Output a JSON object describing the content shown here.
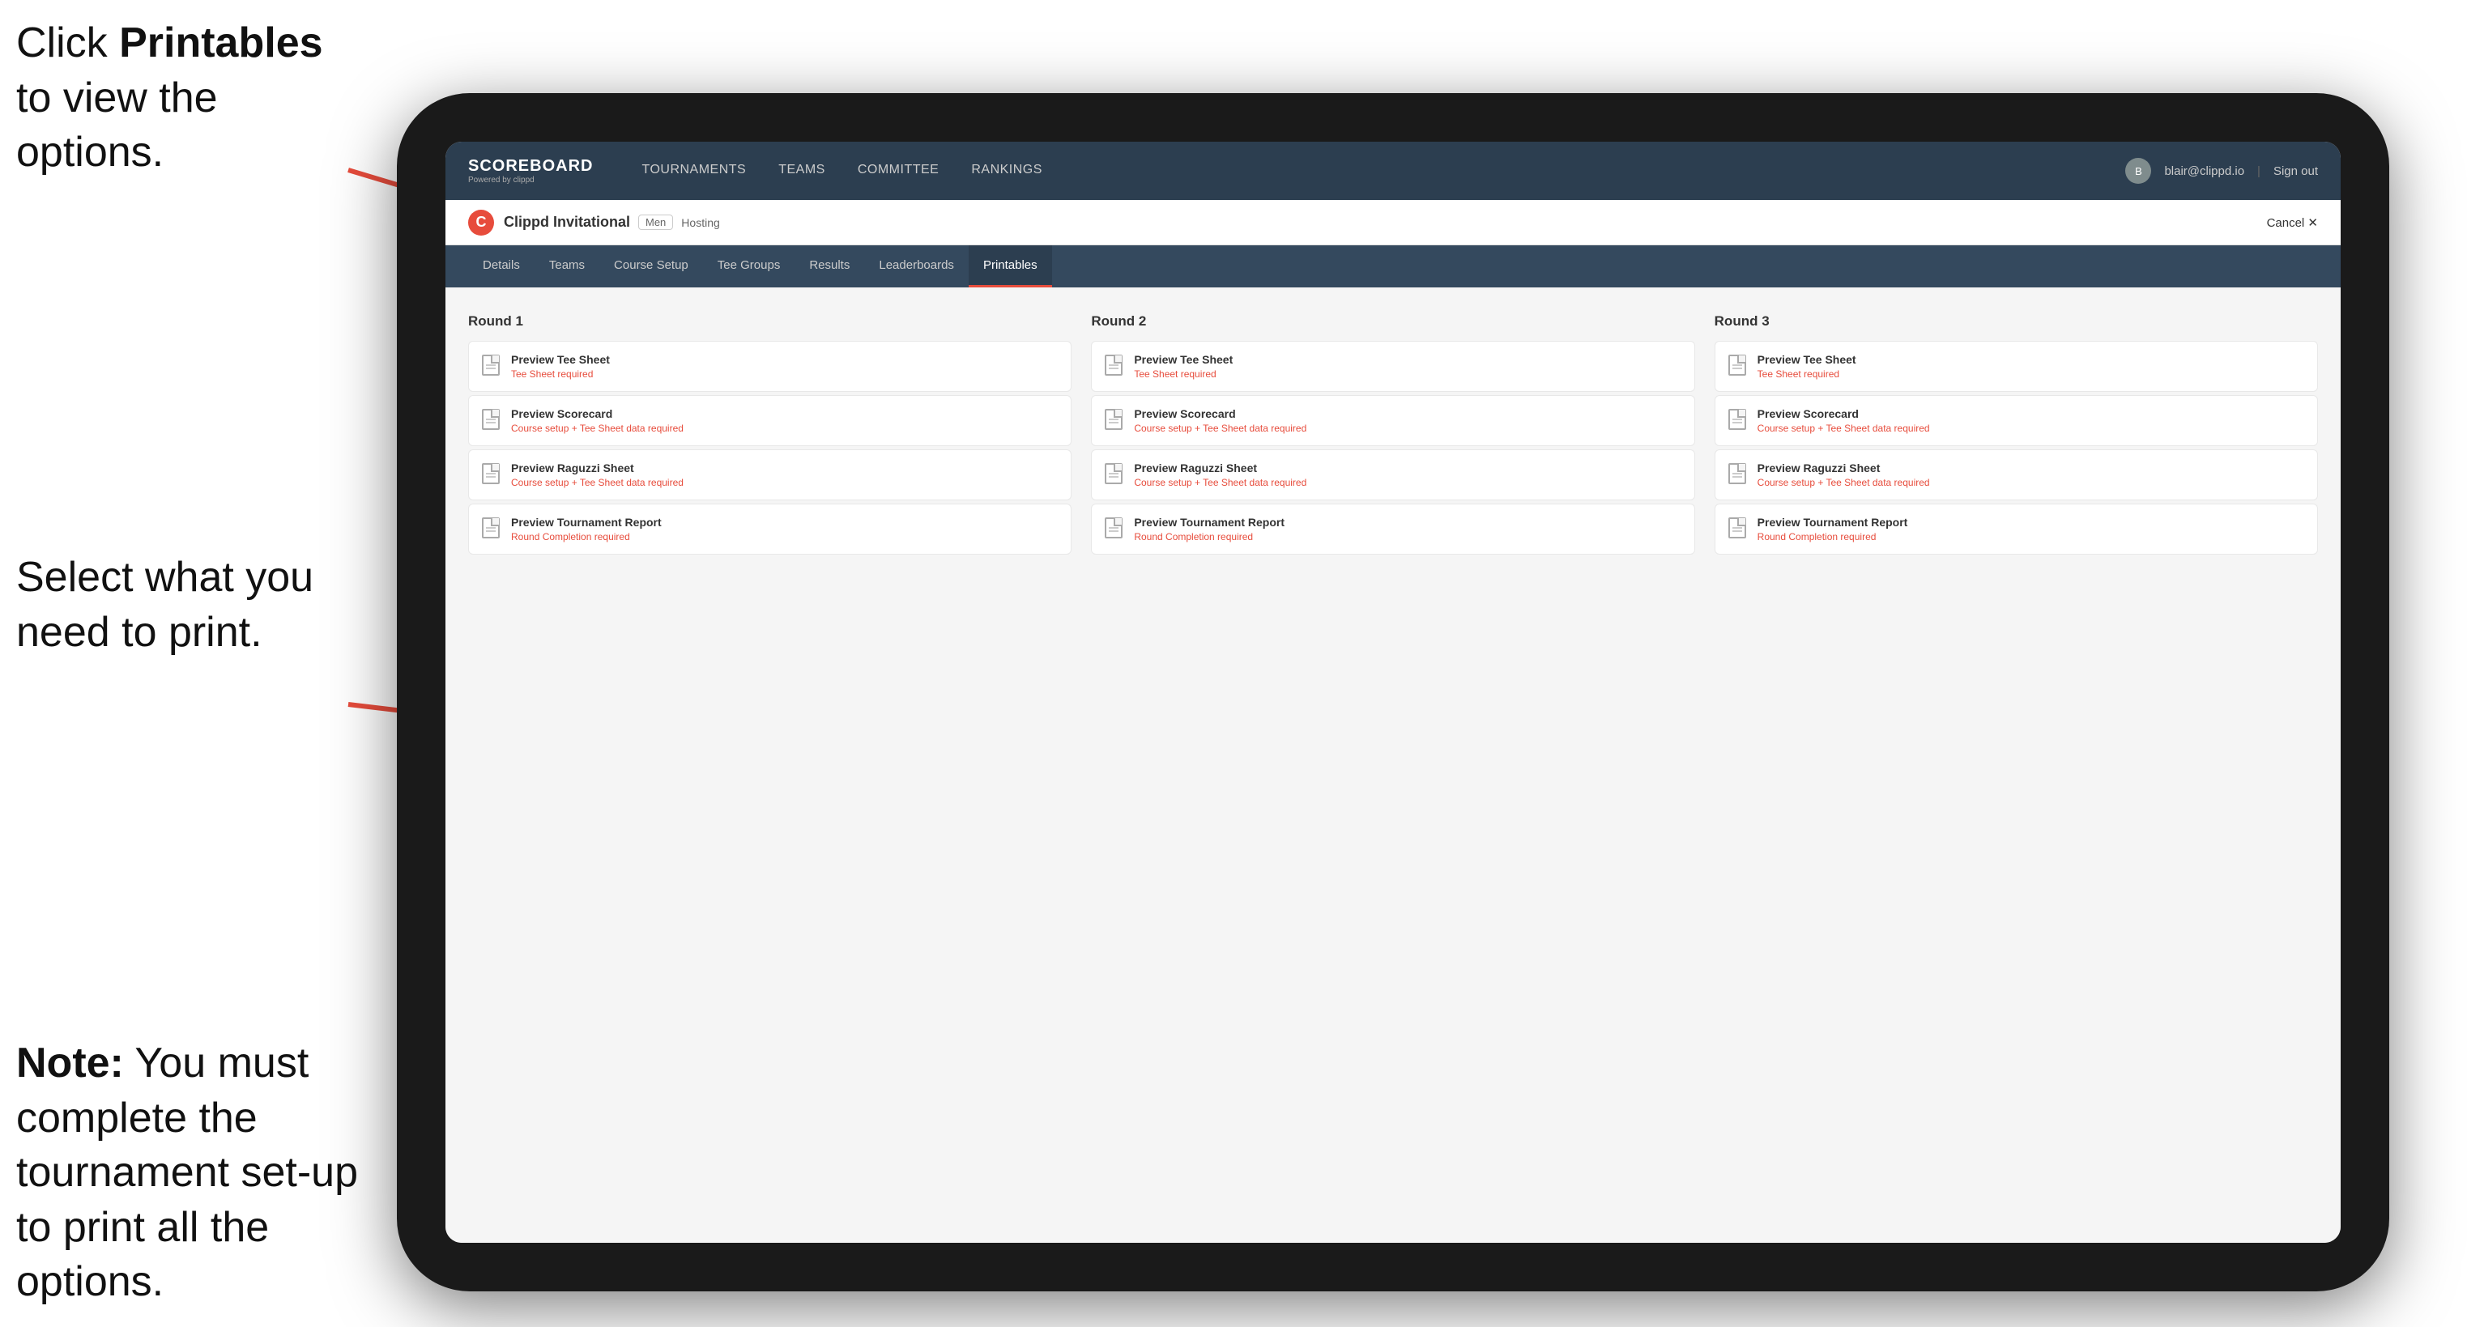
{
  "annotations": {
    "top": {
      "prefix": "Click ",
      "bold": "Printables",
      "suffix": " to view the options."
    },
    "middle": {
      "text": "Select what you need to print."
    },
    "bottom": {
      "bold": "Note:",
      "suffix": " You must complete the tournament set-up to print all the options."
    }
  },
  "topnav": {
    "brand": "SCOREBOARD",
    "brand_sub": "Powered by clippd",
    "items": [
      {
        "label": "TOURNAMENTS",
        "active": false
      },
      {
        "label": "TEAMS",
        "active": false
      },
      {
        "label": "COMMITTEE",
        "active": false
      },
      {
        "label": "RANKINGS",
        "active": false
      }
    ],
    "user_email": "blair@clippd.io",
    "sign_out": "Sign out"
  },
  "tournament_bar": {
    "logo_letter": "C",
    "name": "Clippd Invitational",
    "badge": "Men",
    "status": "Hosting",
    "cancel": "Cancel ✕"
  },
  "subnav": {
    "items": [
      {
        "label": "Details",
        "active": false
      },
      {
        "label": "Teams",
        "active": false
      },
      {
        "label": "Course Setup",
        "active": false
      },
      {
        "label": "Tee Groups",
        "active": false
      },
      {
        "label": "Results",
        "active": false
      },
      {
        "label": "Leaderboards",
        "active": false
      },
      {
        "label": "Printables",
        "active": true
      }
    ]
  },
  "rounds": [
    {
      "title": "Round 1",
      "cards": [
        {
          "title": "Preview Tee Sheet",
          "subtitle": "Tee Sheet required"
        },
        {
          "title": "Preview Scorecard",
          "subtitle": "Course setup + Tee Sheet data required"
        },
        {
          "title": "Preview Raguzzi Sheet",
          "subtitle": "Course setup + Tee Sheet data required"
        },
        {
          "title": "Preview Tournament Report",
          "subtitle": "Round Completion required"
        }
      ]
    },
    {
      "title": "Round 2",
      "cards": [
        {
          "title": "Preview Tee Sheet",
          "subtitle": "Tee Sheet required"
        },
        {
          "title": "Preview Scorecard",
          "subtitle": "Course setup + Tee Sheet data required"
        },
        {
          "title": "Preview Raguzzi Sheet",
          "subtitle": "Course setup + Tee Sheet data required"
        },
        {
          "title": "Preview Tournament Report",
          "subtitle": "Round Completion required"
        }
      ]
    },
    {
      "title": "Round 3",
      "cards": [
        {
          "title": "Preview Tee Sheet",
          "subtitle": "Tee Sheet required"
        },
        {
          "title": "Preview Scorecard",
          "subtitle": "Course setup + Tee Sheet data required"
        },
        {
          "title": "Preview Raguzzi Sheet",
          "subtitle": "Course setup + Tee Sheet data required"
        },
        {
          "title": "Preview Tournament Report",
          "subtitle": "Round Completion required"
        }
      ]
    }
  ]
}
